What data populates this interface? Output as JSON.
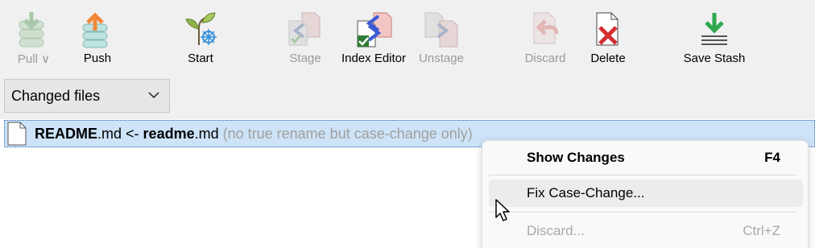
{
  "toolbar": {
    "pull": "Pull ∨",
    "push": "Push",
    "start": "Start",
    "stage": "Stage",
    "index_editor": "Index Editor",
    "unstage": "Unstage",
    "discard": "Discard",
    "delete": "Delete",
    "save_stash": "Save Stash"
  },
  "view_select": {
    "value": "Changed files"
  },
  "file": {
    "name_new": "README",
    "ext_new": ".md",
    "arrow": " <- ",
    "name_old": "readme",
    "ext_old": ".md",
    "note": " (no true rename but case-change only)"
  },
  "context_menu": {
    "show_changes": "Show Changes",
    "show_changes_key": "F4",
    "fix_case": "Fix Case-Change...",
    "discard": "Discard...",
    "discard_key": "Ctrl+Z"
  }
}
